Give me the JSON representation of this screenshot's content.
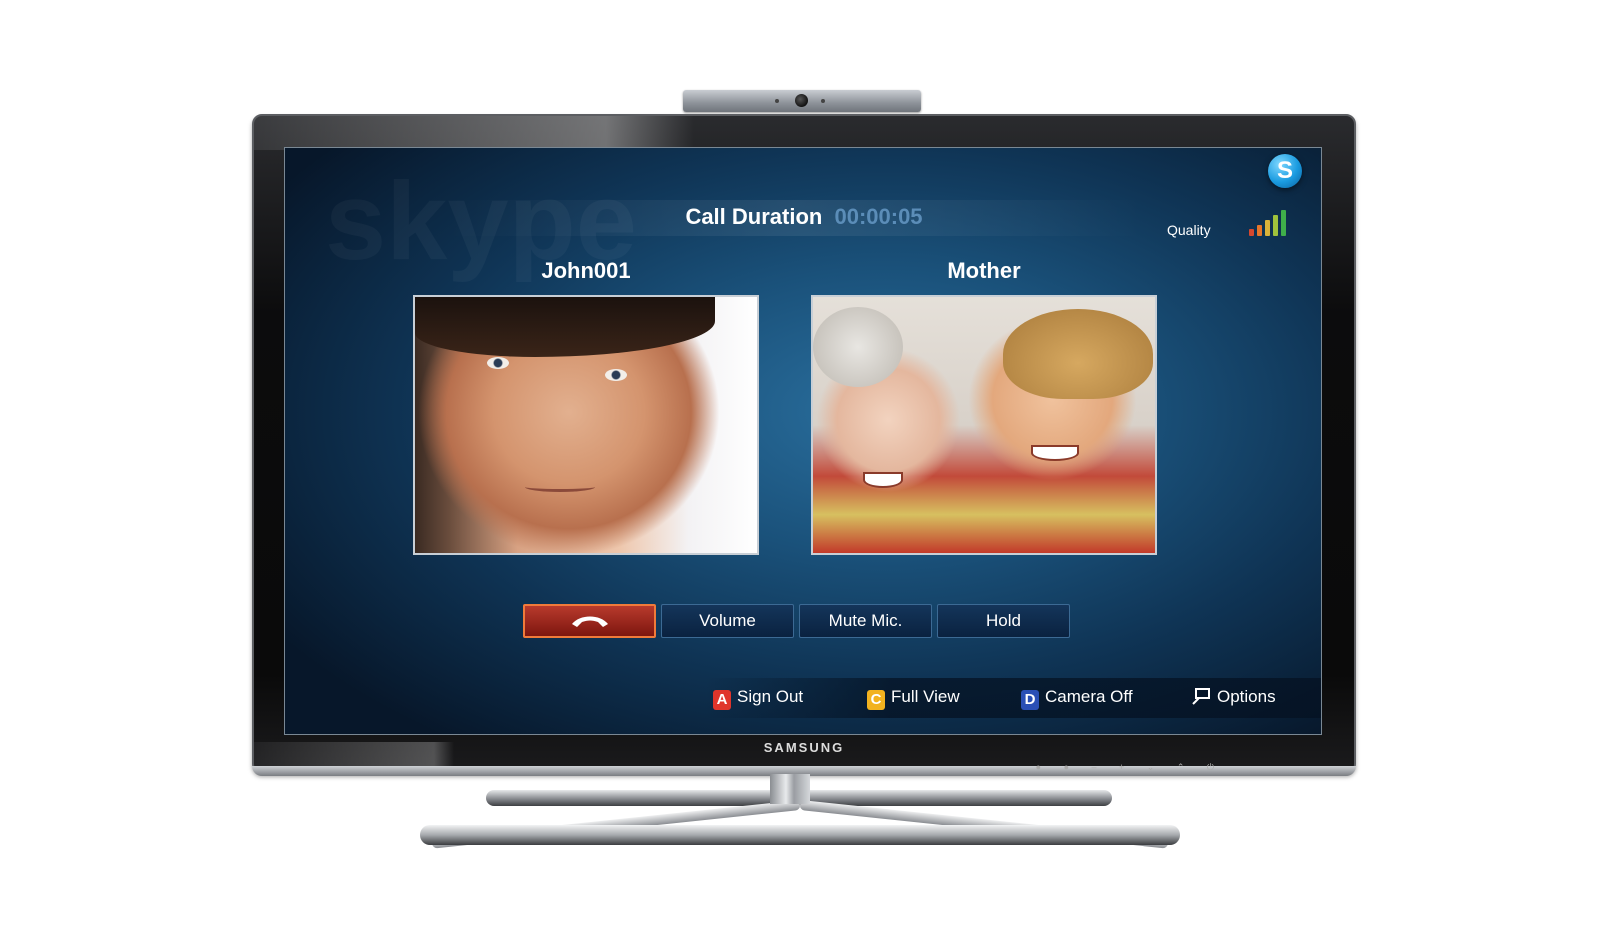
{
  "call": {
    "duration_label": "Call Duration",
    "duration_value": "00:00:05",
    "quality_label": "Quality",
    "quality_level": 5
  },
  "participants": [
    {
      "name": "John001"
    },
    {
      "name": "Mother"
    }
  ],
  "controls": {
    "volume": "Volume",
    "mute": "Mute Mic.",
    "hold": "Hold"
  },
  "shortcuts": [
    {
      "key": "A",
      "label": "Sign Out",
      "color": "#e0352b"
    },
    {
      "key": "C",
      "label": "Full View",
      "color": "#f2b21f"
    },
    {
      "key": "D",
      "label": "Camera Off",
      "color": "#2a4fb5"
    },
    {
      "key": "",
      "label": "Options",
      "icon": "options-icon"
    }
  ],
  "brand": "SAMSUNG",
  "colors": {
    "accent_blue": "#1a517a",
    "end_call_red": "#b83a2c",
    "duration_value": "#5b8db8"
  },
  "icons": [
    "skype-logo-icon",
    "phone-hangup-icon",
    "signal-bars-icon",
    "options-icon",
    "webcam-icon"
  ]
}
